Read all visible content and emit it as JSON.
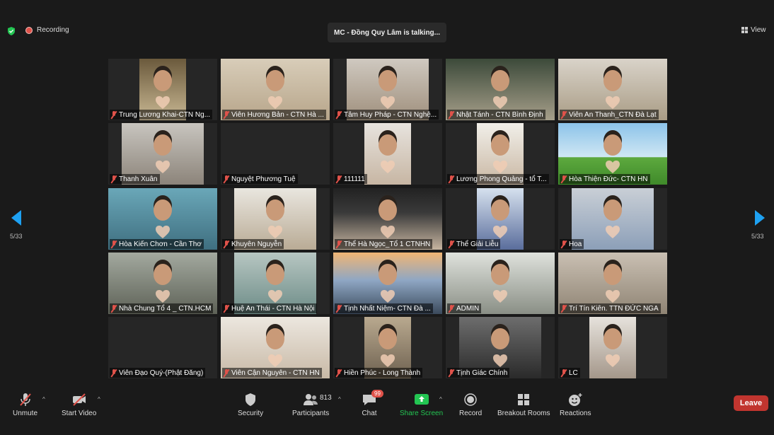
{
  "header": {
    "recording_label": "Recording",
    "talking_label": "MC - Đồng Quy Lâm is talking...",
    "view_label": "View"
  },
  "pagination": {
    "left": "5/33",
    "right": "5/33"
  },
  "participants": [
    {
      "name": "Trung Lương Khai-CTN Ng...",
      "video": true
    },
    {
      "name": "Viên Hương Bản - CTN Hà ...",
      "video": true
    },
    {
      "name": "Tâm Huy Pháp - CTN Nghệ...",
      "video": true
    },
    {
      "name": "Nhật Tánh - CTN Bình Định",
      "video": true
    },
    {
      "name": "Viên An Thanh_CTN Đà Lạt",
      "video": true
    },
    {
      "name": "Thanh Xuân",
      "video": true
    },
    {
      "name": "Nguyệt Phương Tuệ",
      "video": false
    },
    {
      "name": "111111",
      "video": true
    },
    {
      "name": "Lương Phong Quảng - tổ T...",
      "video": true
    },
    {
      "name": "Hòa Thiện Đức- CTN HN",
      "video": true
    },
    {
      "name": "Hòa Kiến Chơn - Cần Thơ",
      "video": true
    },
    {
      "name": "Khuyên Nguyễn",
      "video": true
    },
    {
      "name": "Thể Hà Ngọc_Tổ 1 CTNHN",
      "video": true
    },
    {
      "name": "Thể Giải Liễu",
      "video": true
    },
    {
      "name": "Hoa",
      "video": true
    },
    {
      "name": "Nhà Chung Tổ 4 _ CTN.HCM",
      "video": true
    },
    {
      "name": "Huệ An Thái - CTN Hà Nội",
      "video": true
    },
    {
      "name": "Tịnh Nhất Niệm- CTN Đà ...",
      "video": true
    },
    {
      "name": "ADMIN",
      "video": true
    },
    {
      "name": "Trí Tín Kiên. TTN ĐỨC NGA",
      "video": true
    },
    {
      "name": "Viên Đạo Quý-(Phật Đăng)",
      "video": false
    },
    {
      "name": "Viên Cận Nguyên - CTN HN",
      "video": true
    },
    {
      "name": "Hiền Phúc - Long Thành",
      "video": true
    },
    {
      "name": "Tịnh Giác Chính",
      "video": true
    },
    {
      "name": "LC",
      "video": true
    }
  ],
  "toolbar": {
    "unmute_label": "Unmute",
    "start_video_label": "Start Video",
    "security_label": "Security",
    "participants_label": "Participants",
    "participants_count": "813",
    "chat_label": "Chat",
    "chat_badge": "99",
    "share_screen_label": "Share Screen",
    "record_label": "Record",
    "breakout_label": "Breakout Rooms",
    "reactions_label": "Reactions",
    "leave_label": "Leave"
  },
  "colors": {
    "background": "#1a1a1a",
    "tile": "#262626",
    "accent_blue": "#1ea1f2",
    "share_green": "#23c552",
    "leave_red": "#c1352f",
    "mute_red": "#e0524a"
  }
}
